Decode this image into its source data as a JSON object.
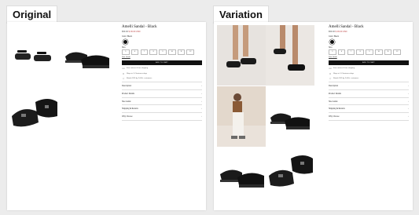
{
  "labels": {
    "original": "Original",
    "variation": "Variation"
  },
  "product": {
    "title": "Amelli Sandal - Black",
    "price_regular": "$59.00",
    "price_sale": "$ 39.00 USD",
    "color_label": "Color: Black",
    "size_label": "Size",
    "sizes": [
      "5",
      "6",
      "7",
      "8",
      "9",
      "10",
      "11",
      "12"
    ],
    "size_guide": "Size Guide",
    "add_to_cart": "ADD TO CART",
    "perks": [
      "Free returns & free shipping",
      "Ships in 1-2 business days",
      "Rated 4.9/5 by 2,000+ customers"
    ],
    "accordion": [
      "Description",
      "Product Details",
      "Size Guide",
      "Shipping & Returns",
      "Why Choose"
    ]
  },
  "icons": {
    "chevron": "chevron-down-icon",
    "perk_icons": [
      "truck-icon",
      "box-icon",
      "star-icon"
    ]
  },
  "colors": {
    "accent": "#111111",
    "sale": "#b44444"
  }
}
